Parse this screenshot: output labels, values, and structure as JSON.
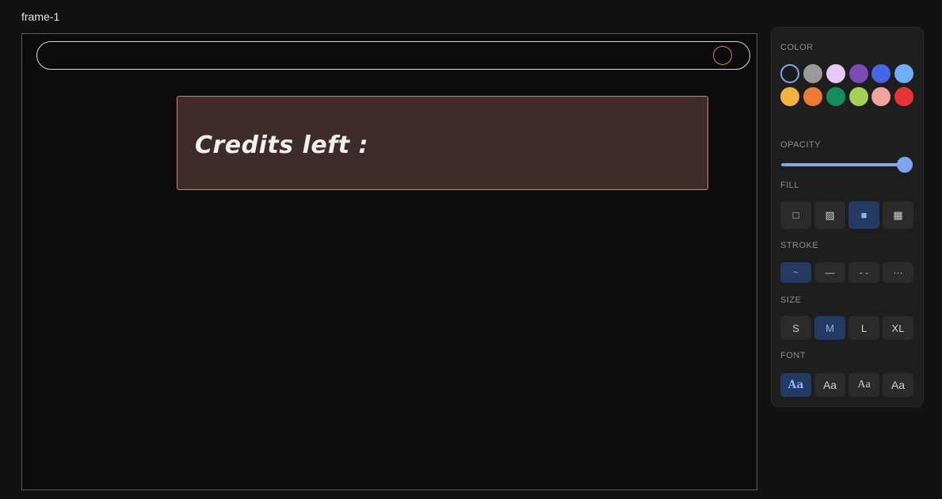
{
  "frame": {
    "label": "frame-1"
  },
  "canvas": {
    "credits_text": "Credits left :",
    "accent_stroke": "#e07a72",
    "box_fill": "#3e2b2b"
  },
  "panel": {
    "color_label": "COLOR",
    "colors": [
      "#1e1e1e",
      "#9a9a9a",
      "#e5c7f8",
      "#7c4bb3",
      "#4866e8",
      "#6eaef7",
      "#f4b33e",
      "#ec7a35",
      "#138c5e",
      "#a6cf56",
      "#f2a3a0",
      "#e53535"
    ],
    "selected_color_index": 0,
    "opacity_label": "OPACITY",
    "opacity_value": 1.0,
    "fill_label": "FILL",
    "fill_options": [
      "□",
      "▨",
      "■",
      "▦"
    ],
    "fill_selected_index": 2,
    "stroke_label": "STROKE",
    "stroke_options": [
      "~",
      "—",
      "- -",
      "···"
    ],
    "stroke_selected_index": 0,
    "size_label": "SIZE",
    "size_options": [
      "S",
      "M",
      "L",
      "XL"
    ],
    "size_selected_index": 1,
    "font_label": "FONT",
    "font_options": [
      "Aa",
      "Aa",
      "Aa",
      "Aa"
    ],
    "font_selected_index": 0
  }
}
